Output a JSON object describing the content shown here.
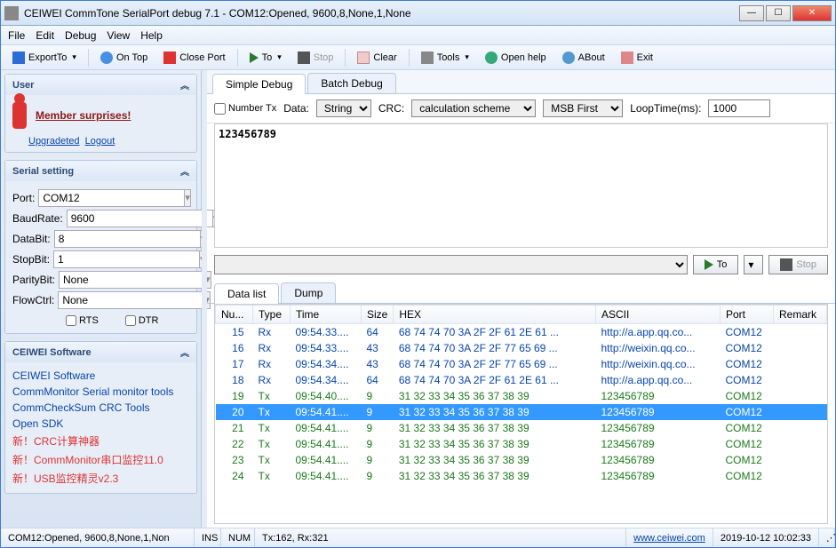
{
  "title": "CEIWEI CommTone SerialPort debug 7.1 - COM12:Opened, 9600,8,None,1,None",
  "menu": {
    "file": "File",
    "edit": "Edit",
    "debug": "Debug",
    "view": "View",
    "help": "Help"
  },
  "toolbar": {
    "exportto": "ExportTo",
    "ontop": "On Top",
    "closeport": "Close Port",
    "to": "To",
    "stop": "Stop",
    "clear": "Clear",
    "tools": "Tools",
    "openhelp": "Open help",
    "about": "ABout",
    "exit": "Exit"
  },
  "sidebar": {
    "user": {
      "title": "User",
      "member": "Member surprises!",
      "upgraded": "Upgradeted",
      "logout": "Logout"
    },
    "serial": {
      "title": "Serial setting",
      "port_label": "Port:",
      "port": "COM12",
      "baud_label": "BaudRate:",
      "baud": "9600",
      "databit_label": "DataBit:",
      "databit": "8",
      "stopbit_label": "StopBit:",
      "stopbit": "1",
      "parity_label": "ParityBit:",
      "parity": "None",
      "flow_label": "FlowCtrl:",
      "flow": "None",
      "rts": "RTS",
      "dtr": "DTR"
    },
    "software": {
      "title": "CEIWEI Software",
      "l1": "CEIWEI Software",
      "l2": "CommMonitor Serial monitor tools",
      "l3": "CommCheckSum CRC Tools",
      "l4": "Open SDK",
      "l5": "新！CRC计算神器",
      "l6": "新！CommMonitor串口监控11.0",
      "l7": "新！USB监控精灵v2.3"
    }
  },
  "main": {
    "tabs": {
      "simple": "Simple Debug",
      "batch": "Batch Debug"
    },
    "config": {
      "numbertx": "Number Tx",
      "data_label": "Data:",
      "data_val": "String",
      "crc_label": "CRC:",
      "crc_val": "calculation scheme",
      "msb": "MSB First",
      "looptime_label": "LoopTime(ms):",
      "looptime_val": "1000"
    },
    "txcontent": "123456789",
    "send_to": "To",
    "send_stop": "Stop",
    "tabs2": {
      "datalist": "Data list",
      "dump": "Dump"
    },
    "cols": {
      "num": "Nu...",
      "type": "Type",
      "time": "Time",
      "size": "Size",
      "hex": "HEX",
      "ascii": "ASCII",
      "port": "Port",
      "remark": "Remark"
    },
    "rows": [
      {
        "n": "15",
        "t": "Rx",
        "time": "09:54.33....",
        "size": "64",
        "hex": "68 74 74 70 3A 2F 2F 61 2E 61 ...",
        "ascii": "http://a.app.qq.co...",
        "port": "COM12",
        "cls": "rx"
      },
      {
        "n": "16",
        "t": "Rx",
        "time": "09:54.33....",
        "size": "43",
        "hex": "68 74 74 70 3A 2F 2F 77 65 69 ...",
        "ascii": "http://weixin.qq.co...",
        "port": "COM12",
        "cls": "rx"
      },
      {
        "n": "17",
        "t": "Rx",
        "time": "09:54.34....",
        "size": "43",
        "hex": "68 74 74 70 3A 2F 2F 77 65 69 ...",
        "ascii": "http://weixin.qq.co...",
        "port": "COM12",
        "cls": "rx"
      },
      {
        "n": "18",
        "t": "Rx",
        "time": "09:54.34....",
        "size": "64",
        "hex": "68 74 74 70 3A 2F 2F 61 2E 61 ...",
        "ascii": "http://a.app.qq.co...",
        "port": "COM12",
        "cls": "rx"
      },
      {
        "n": "19",
        "t": "Tx",
        "time": "09:54.40....",
        "size": "9",
        "hex": "31 32 33 34 35 36 37 38 39",
        "ascii": "123456789",
        "port": "COM12",
        "cls": "tx"
      },
      {
        "n": "20",
        "t": "Tx",
        "time": "09:54.41....",
        "size": "9",
        "hex": "31 32 33 34 35 36 37 38 39",
        "ascii": "123456789",
        "port": "COM12",
        "cls": "tx sel"
      },
      {
        "n": "21",
        "t": "Tx",
        "time": "09:54.41....",
        "size": "9",
        "hex": "31 32 33 34 35 36 37 38 39",
        "ascii": "123456789",
        "port": "COM12",
        "cls": "tx"
      },
      {
        "n": "22",
        "t": "Tx",
        "time": "09:54.41....",
        "size": "9",
        "hex": "31 32 33 34 35 36 37 38 39",
        "ascii": "123456789",
        "port": "COM12",
        "cls": "tx"
      },
      {
        "n": "23",
        "t": "Tx",
        "time": "09:54.41....",
        "size": "9",
        "hex": "31 32 33 34 35 36 37 38 39",
        "ascii": "123456789",
        "port": "COM12",
        "cls": "tx"
      },
      {
        "n": "24",
        "t": "Tx",
        "time": "09:54.41....",
        "size": "9",
        "hex": "31 32 33 34 35 36 37 38 39",
        "ascii": "123456789",
        "port": "COM12",
        "cls": "tx"
      }
    ]
  },
  "status": {
    "port": "COM12:Opened, 9600,8,None,1,Non",
    "ins": "INS",
    "num": "NUM",
    "txrx": "Tx:162, Rx:321",
    "url": "www.ceiwei.com",
    "time": "2019-10-12 10:02:33"
  }
}
